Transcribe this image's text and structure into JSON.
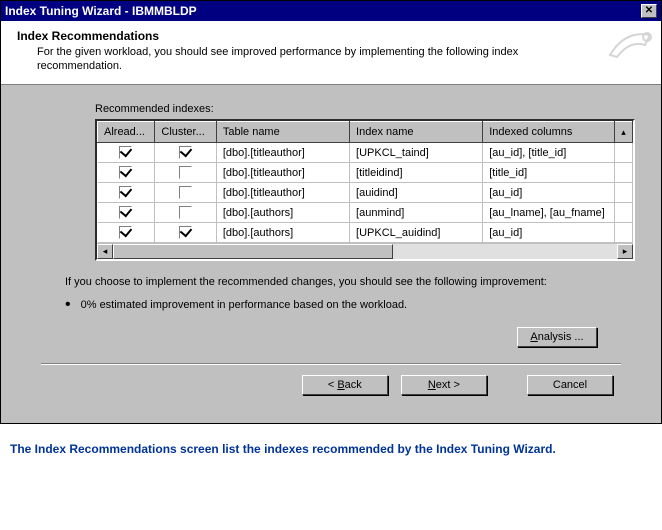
{
  "window": {
    "title": "Index Tuning Wizard - IBMMBLDP"
  },
  "banner": {
    "heading": "Index Recommendations",
    "desc": "For the given workload,  you should see improved performance by implementing the following index recommendation."
  },
  "table": {
    "label": "Recommended indexes:",
    "headers": {
      "already": "Alread...",
      "clustered": "Cluster...",
      "table_name": "Table name",
      "index_name": "Index name",
      "indexed_cols": "Indexed columns"
    },
    "rows": [
      {
        "already": true,
        "clustered": true,
        "table": "[dbo].[titleauthor]",
        "index": "[UPKCL_taind]",
        "cols": "[au_id], [title_id]"
      },
      {
        "already": true,
        "clustered": false,
        "table": "[dbo].[titleauthor]",
        "index": "[titleidind]",
        "cols": "[title_id]"
      },
      {
        "already": true,
        "clustered": false,
        "table": "[dbo].[titleauthor]",
        "index": "[auidind]",
        "cols": "[au_id]"
      },
      {
        "already": true,
        "clustered": false,
        "table": "[dbo].[authors]",
        "index": "[aunmind]",
        "cols": "[au_lname], [au_fname]"
      },
      {
        "already": true,
        "clustered": true,
        "table": "[dbo].[authors]",
        "index": "[UPKCL_auidind]",
        "cols": "[au_id]"
      }
    ]
  },
  "improvement": {
    "intro": "If you choose to implement the recommended changes, you should see the following improvement:",
    "bullet": "0% estimated improvement in performance based on the workload."
  },
  "buttons": {
    "analysis": "Analysis ...",
    "back": "Back",
    "next": "Next",
    "cancel": "Cancel"
  },
  "caption": "The Index Recommendations screen list the indexes recommended by the Index Tuning Wizard."
}
